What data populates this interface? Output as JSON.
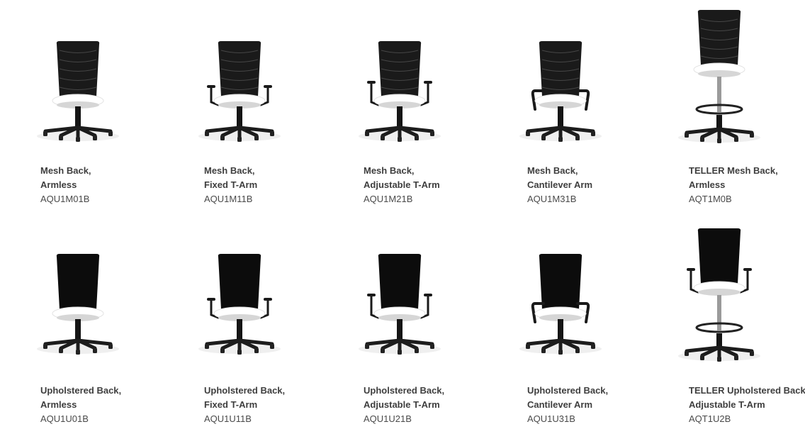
{
  "products": [
    {
      "line1": "Mesh Back,",
      "line2": "Armless",
      "sku": "AQU1M01B",
      "back": "mesh",
      "arms": "none",
      "stool": false
    },
    {
      "line1": "Mesh Back,",
      "line2": "Fixed T-Arm",
      "sku": "AQU1M11B",
      "back": "mesh",
      "arms": "fixed",
      "stool": false
    },
    {
      "line1": "Mesh Back,",
      "line2": "Adjustable T-Arm",
      "sku": "AQU1M21B",
      "back": "mesh",
      "arms": "adjustable",
      "stool": false
    },
    {
      "line1": "Mesh Back,",
      "line2": "Cantilever Arm",
      "sku": "AQU1M31B",
      "back": "mesh",
      "arms": "cantilever",
      "stool": false
    },
    {
      "line1": "TELLER Mesh Back,",
      "line2": "Armless",
      "sku": "AQT1M0B",
      "back": "mesh",
      "arms": "none",
      "stool": true
    },
    {
      "line1": "Upholstered Back,",
      "line2": "Armless",
      "sku": "AQU1U01B",
      "back": "upholstered",
      "arms": "none",
      "stool": false
    },
    {
      "line1": "Upholstered Back,",
      "line2": "Fixed T-Arm",
      "sku": "AQU1U11B",
      "back": "upholstered",
      "arms": "fixed",
      "stool": false
    },
    {
      "line1": "Upholstered Back,",
      "line2": "Adjustable T-Arm",
      "sku": "AQU1U21B",
      "back": "upholstered",
      "arms": "adjustable",
      "stool": false
    },
    {
      "line1": "Upholstered Back,",
      "line2": "Cantilever Arm",
      "sku": "AQU1U31B",
      "back": "upholstered",
      "arms": "cantilever",
      "stool": false
    },
    {
      "line1": "TELLER Upholstered Back,",
      "line2": "Adjustable  T-Arm",
      "sku": "AQT1U2B",
      "back": "upholstered",
      "arms": "adjustable",
      "stool": true
    }
  ]
}
